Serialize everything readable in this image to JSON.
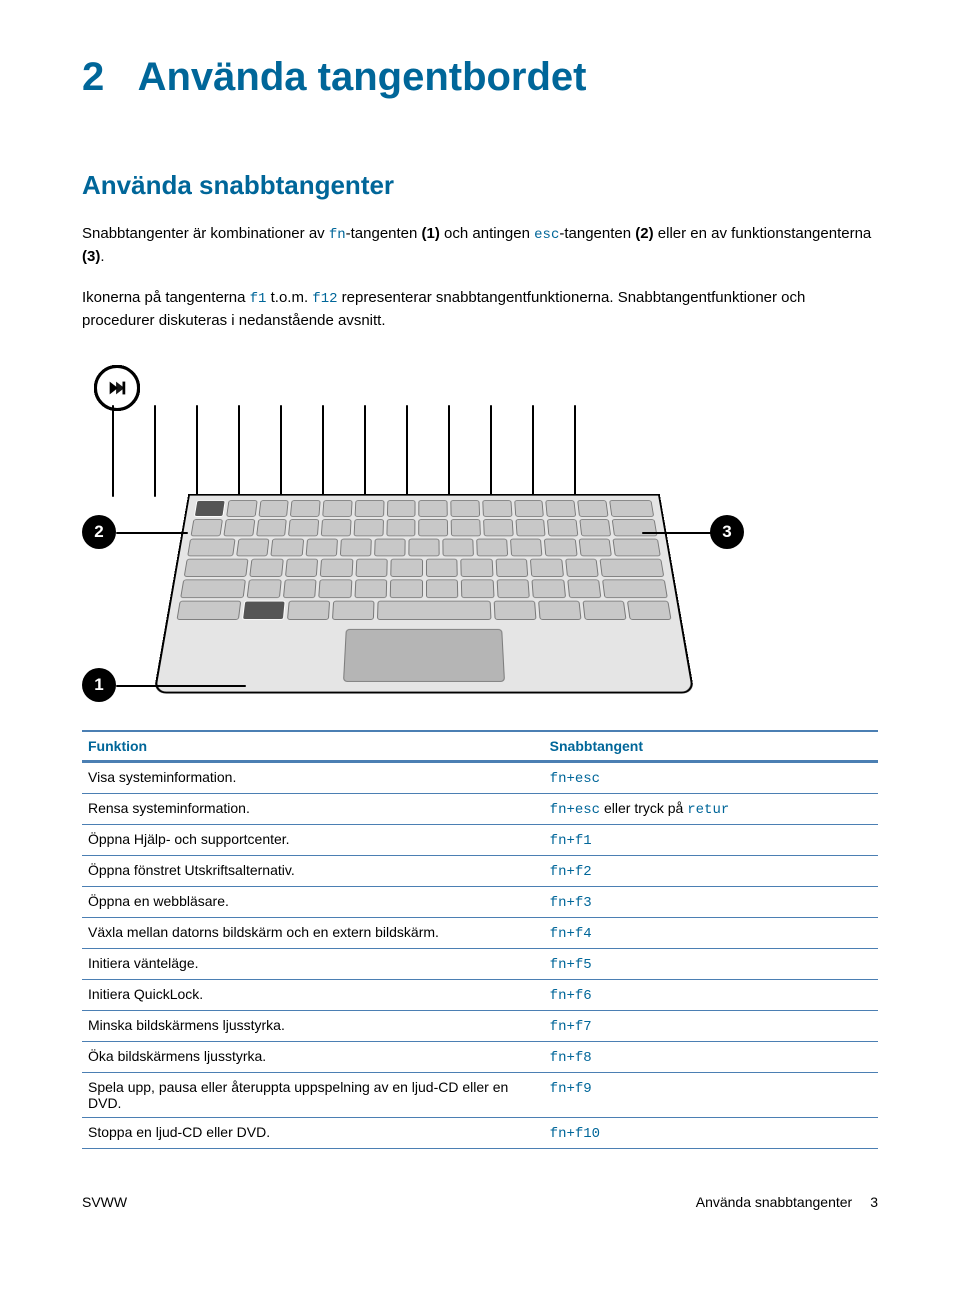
{
  "chapter": {
    "number": "2",
    "title": "Använda tangentbordet"
  },
  "section": {
    "title": "Använda snabbtangenter"
  },
  "intro": {
    "p1_a": "Snabbtangenter är kombinationer av ",
    "fn": "fn",
    "p1_b": "-tangenten ",
    "ref1": "(1)",
    "p1_c": " och antingen ",
    "esc": "esc",
    "p1_d": "-tangenten ",
    "ref2": "(2)",
    "p1_e": " eller en av funktionstangenterna ",
    "ref3": "(3)",
    "p1_f": ".",
    "p2_a": "Ikonerna på tangenterna ",
    "f1": "f1",
    "p2_b": " t.o.m. ",
    "f12": "f12",
    "p2_c": " representerar snabbtangentfunktionerna. Snabbtangentfunktioner och procedurer diskuteras i nedanstående avsnitt."
  },
  "callouts": {
    "one": "1",
    "two": "2",
    "three": "3"
  },
  "table": {
    "headers": {
      "function": "Funktion",
      "hotkey": "Snabbtangent"
    },
    "rows": [
      {
        "func": "Visa systeminformation.",
        "hot": "fn+esc"
      },
      {
        "func": "Rensa systeminformation.",
        "hot": "fn+esc",
        "suffix": " eller tryck på ",
        "retur": "retur"
      },
      {
        "func": "Öppna Hjälp- och supportcenter.",
        "hot": "fn+f1"
      },
      {
        "func": "Öppna fönstret Utskriftsalternativ.",
        "hot": "fn+f2"
      },
      {
        "func": "Öppna en webbläsare.",
        "hot": "fn+f3"
      },
      {
        "func": "Växla mellan datorns bildskärm och en extern bildskärm.",
        "hot": "fn+f4"
      },
      {
        "func": "Initiera vänteläge.",
        "hot": "fn+f5"
      },
      {
        "func": "Initiera QuickLock.",
        "hot": "fn+f6"
      },
      {
        "func": "Minska bildskärmens ljusstyrka.",
        "hot": "fn+f7"
      },
      {
        "func": "Öka bildskärmens ljusstyrka.",
        "hot": "fn+f8"
      },
      {
        "func": "Spela upp, pausa eller återuppta uppspelning av en ljud-CD eller en DVD.",
        "hot": "fn+f9"
      },
      {
        "func": "Stoppa en ljud-CD eller DVD.",
        "hot": "fn+f10"
      }
    ]
  },
  "footer": {
    "left": "SVWW",
    "right_label": "Använda snabbtangenter",
    "page": "3"
  }
}
